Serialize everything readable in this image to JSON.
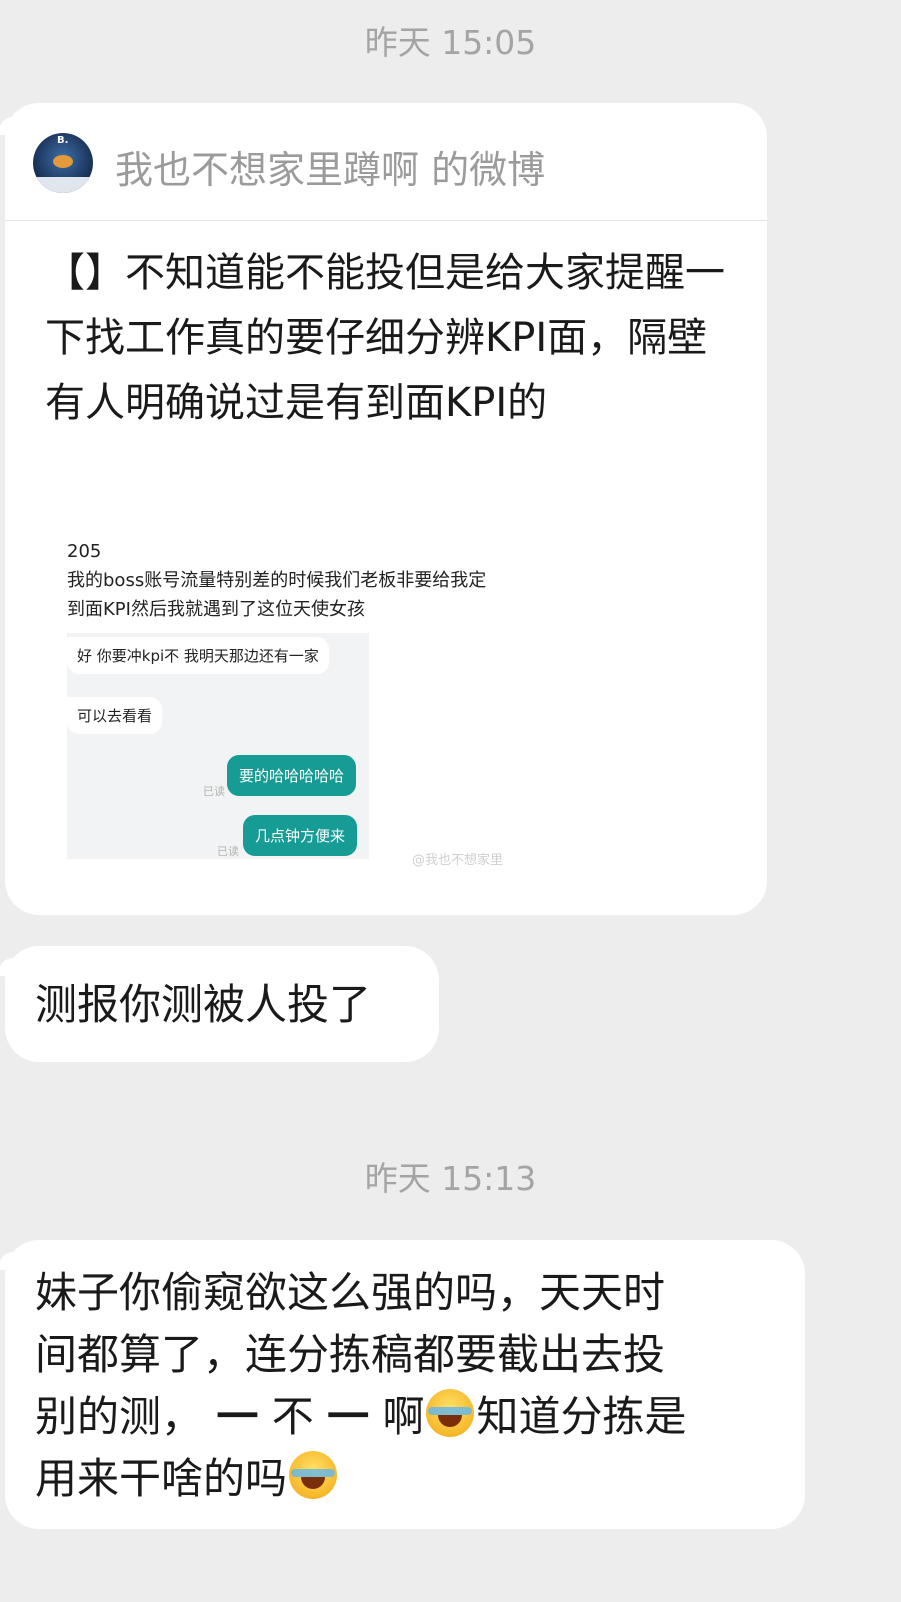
{
  "timestamp_1": "昨天 15:05",
  "card": {
    "header_title": "我也不想家里蹲啊 的微博",
    "body_text": "【】不知道能不能投但是给大家提醒一下找工作真的要仔细分辨KPI面，隔壁有人明确说过是有到面KPI的",
    "image": {
      "number": "205",
      "caption": "我的boss账号流量特别差的时候我们老板非要给我定到面KPI然后我就遇到了这位天使女孩",
      "msg_in_1": "好 你要冲kpi不  我明天那边还有一家",
      "msg_in_2": "可以去看看",
      "msg_out_1": "要的哈哈哈哈哈",
      "msg_out_2": "几点钟方便来",
      "read_1": "已读",
      "read_2": "已读",
      "watermark": "@我也不想家里"
    }
  },
  "message_1": "测报你测被人投了",
  "timestamp_2": "昨天 15:13",
  "message_2": {
    "line_1": "妹子你偷窥欲这么强的吗，天天时",
    "line_2": "间都算了，连分拣稿都要截出去投",
    "line_3a": "别的测，  ",
    "line_3b": "一",
    "line_3c": " 不 ",
    "line_3d": "一",
    "line_3e": " 啊",
    "line_3f": "知道分拣是",
    "line_4a": "用来干啥的吗",
    "emoji": "face-with-tears-of-joy-icon"
  }
}
